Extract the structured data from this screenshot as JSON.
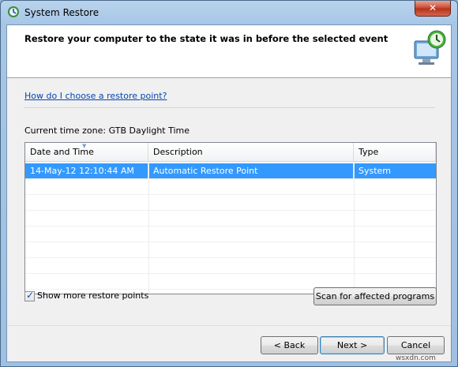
{
  "window": {
    "title": "System Restore",
    "close_label": "✕"
  },
  "header": {
    "title": "Restore your computer to the state it was in before the selected event"
  },
  "help_link": "How do I choose a restore point?",
  "timezone": "Current time zone: GTB Daylight Time",
  "list": {
    "columns": [
      "Date and Time",
      "Description",
      "Type"
    ],
    "rows": [
      {
        "date": "14-May-12 12:10:44 AM",
        "description": "Automatic Restore Point",
        "type": "System"
      }
    ]
  },
  "show_more": {
    "label": "Show more restore points",
    "checked": true,
    "check_glyph": "✓"
  },
  "buttons": {
    "scan": "Scan for affected programs",
    "back": "< Back",
    "next": "Next >",
    "cancel": "Cancel"
  },
  "watermark": "wsxdn.com",
  "colors": {
    "selection": "#3399ff",
    "link": "#0645ad",
    "close": "#c7452c"
  }
}
